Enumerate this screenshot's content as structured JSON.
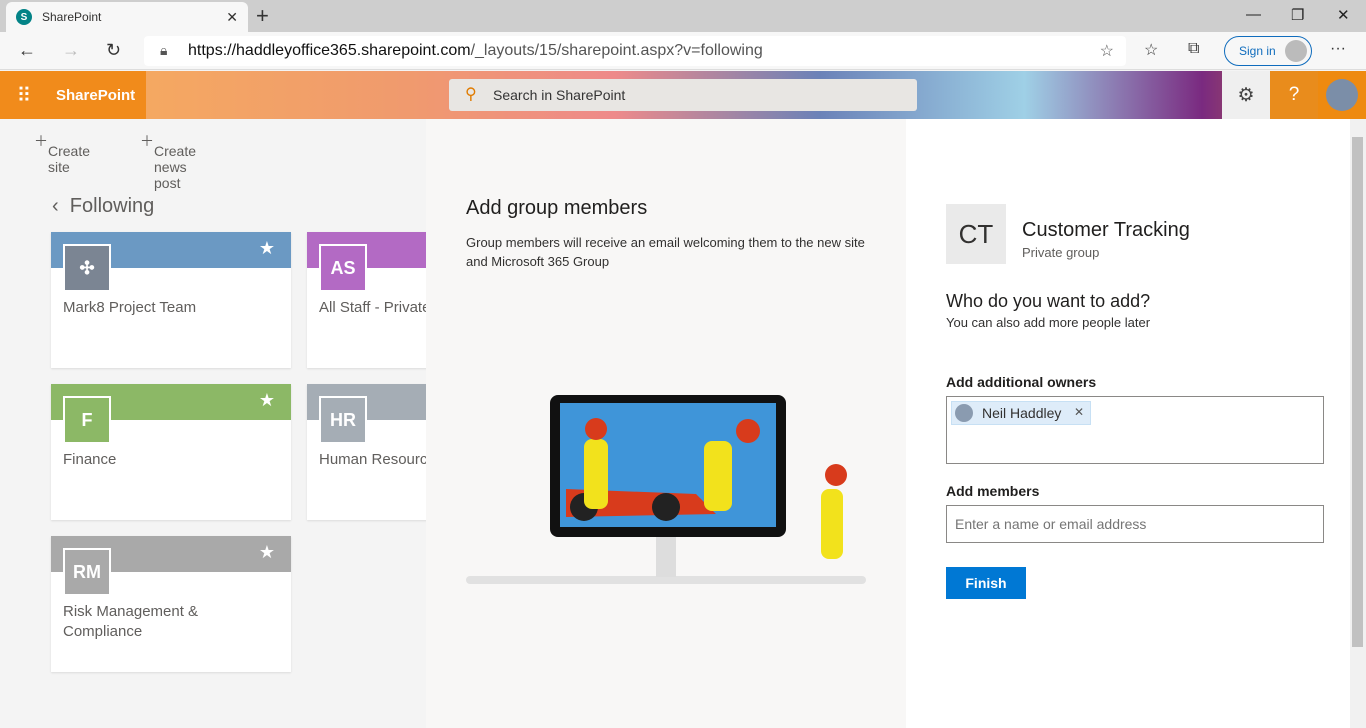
{
  "browser": {
    "tab_title": "SharePoint",
    "url_host": "https://haddleyoffice365.sharepoint.com",
    "url_path": "/_layouts/15/sharepoint.aspx?v=following",
    "sign_in": "Sign in"
  },
  "header": {
    "brand": "SharePoint",
    "search_placeholder": "Search in SharePoint",
    "help": "?"
  },
  "commands": {
    "create_site": "Create site",
    "create_news": "Create news post"
  },
  "following": {
    "title": "Following",
    "sites": [
      {
        "initials": "",
        "name": "Mark8 Project Team",
        "color": "#6b99c3"
      },
      {
        "initials": "AS",
        "name": "All Staff - Private",
        "color": "#b36ac4"
      },
      {
        "initials": "F",
        "name": "Finance",
        "color": "#8cb866"
      },
      {
        "initials": "HR",
        "name": "Human Resources",
        "color": "#a5adb5"
      },
      {
        "initials": "RM",
        "name": "Risk Management & Compliance",
        "color": "#a9a9a9"
      }
    ]
  },
  "panel": {
    "title": "Add group members",
    "description": "Group members will receive an email welcoming them to the new site and Microsoft 365 Group",
    "group_initials": "CT",
    "group_name": "Customer Tracking",
    "group_type": "Private group",
    "question": "Who do you want to add?",
    "question_sub": "You can also add more people later",
    "owners_label": "Add additional owners",
    "owner": "Neil Haddley",
    "members_label": "Add members",
    "members_placeholder": "Enter a name or email address",
    "finish": "Finish"
  }
}
